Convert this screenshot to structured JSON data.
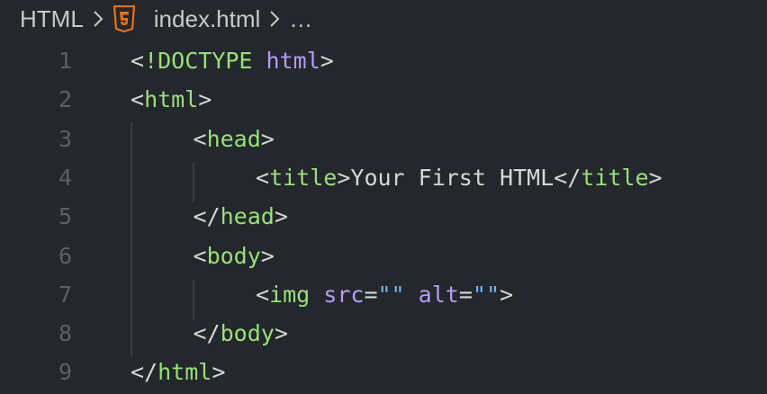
{
  "breadcrumb": {
    "root": "HTML",
    "file": "index.html",
    "more": "…"
  },
  "colors": {
    "background": "#24272b",
    "tag": "#98e07a",
    "attribute": "#b69cf3",
    "string": "#6fb6ff",
    "text": "#d6d7d9",
    "line_number": "#5b5f66",
    "html5_icon": "#e8711a"
  },
  "icons": {
    "separator": "chevron-right-icon",
    "file": "html5-icon"
  },
  "lines": [
    {
      "number": "1",
      "tokens": [
        {
          "t": "<",
          "k": "punc"
        },
        {
          "t": "!DOCTYPE",
          "k": "kw"
        },
        {
          "t": " ",
          "k": "txt"
        },
        {
          "t": "html",
          "k": "attr"
        },
        {
          "t": ">",
          "k": "punc"
        }
      ]
    },
    {
      "number": "2",
      "tokens": [
        {
          "t": "<",
          "k": "punc"
        },
        {
          "t": "html",
          "k": "tag"
        },
        {
          "t": ">",
          "k": "punc"
        }
      ]
    },
    {
      "number": "3",
      "tokens": [
        {
          "t": "<",
          "k": "punc"
        },
        {
          "t": "head",
          "k": "tag"
        },
        {
          "t": ">",
          "k": "punc"
        }
      ]
    },
    {
      "number": "4",
      "tokens": [
        {
          "t": "<",
          "k": "punc"
        },
        {
          "t": "title",
          "k": "tag"
        },
        {
          "t": ">",
          "k": "punc"
        },
        {
          "t": "Your First HTML",
          "k": "txt"
        },
        {
          "t": "</",
          "k": "punc"
        },
        {
          "t": "title",
          "k": "tag"
        },
        {
          "t": ">",
          "k": "punc"
        }
      ]
    },
    {
      "number": "5",
      "tokens": [
        {
          "t": "</",
          "k": "punc"
        },
        {
          "t": "head",
          "k": "tag"
        },
        {
          "t": ">",
          "k": "punc"
        }
      ]
    },
    {
      "number": "6",
      "tokens": [
        {
          "t": "<",
          "k": "punc"
        },
        {
          "t": "body",
          "k": "tag"
        },
        {
          "t": ">",
          "k": "punc"
        }
      ]
    },
    {
      "number": "7",
      "tokens": [
        {
          "t": "<",
          "k": "punc"
        },
        {
          "t": "img",
          "k": "tag"
        },
        {
          "t": " ",
          "k": "txt"
        },
        {
          "t": "src",
          "k": "attr"
        },
        {
          "t": "=",
          "k": "punc"
        },
        {
          "t": "\"\"",
          "k": "str"
        },
        {
          "t": " ",
          "k": "txt"
        },
        {
          "t": "alt",
          "k": "attr"
        },
        {
          "t": "=",
          "k": "punc"
        },
        {
          "t": "\"\"",
          "k": "str"
        },
        {
          "t": ">",
          "k": "punc"
        }
      ]
    },
    {
      "number": "8",
      "tokens": [
        {
          "t": "</",
          "k": "punc"
        },
        {
          "t": "body",
          "k": "tag"
        },
        {
          "t": ">",
          "k": "punc"
        }
      ]
    },
    {
      "number": "9",
      "tokens": [
        {
          "t": "</",
          "k": "punc"
        },
        {
          "t": "html",
          "k": "tag"
        },
        {
          "t": ">",
          "k": "punc"
        }
      ]
    }
  ]
}
